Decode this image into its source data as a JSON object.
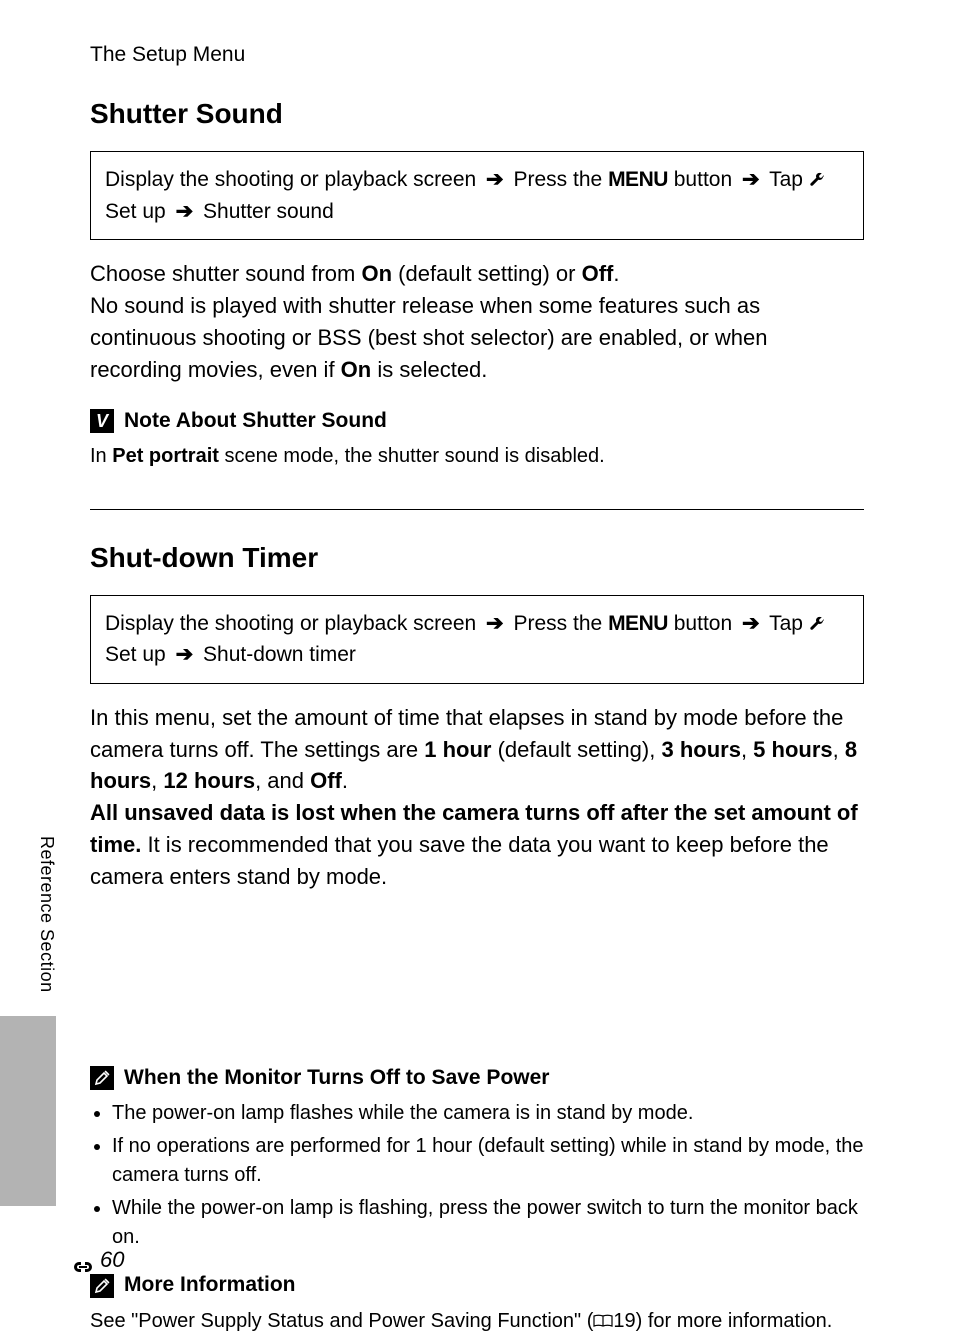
{
  "header": "The Setup Menu",
  "section1": {
    "title": "Shutter Sound",
    "nav": {
      "p1": "Display the shooting or playback screen",
      "p2": "Press the",
      "menu": "MENU",
      "p3": "button",
      "p4": "Tap",
      "p5": "Set up",
      "p6": "Shutter sound"
    },
    "para1_a": "Choose shutter sound from ",
    "para1_on": "On",
    "para1_b": " (default setting) or ",
    "para1_off": "Off",
    "para1_c": ".",
    "para2_a": "No sound is played with shutter release when some features such as continuous shooting or BSS (best shot selector) are enabled, or when recording movies, even if ",
    "para2_on": "On",
    "para2_b": " is selected.",
    "note": {
      "title": "Note About Shutter Sound",
      "body_a": "In ",
      "body_b": "Pet portrait",
      "body_c": " scene mode, the shutter sound is disabled."
    }
  },
  "section2": {
    "title": "Shut-down Timer",
    "nav": {
      "p1": "Display the shooting or playback screen",
      "p2": "Press the",
      "menu": "MENU",
      "p3": "button",
      "p4": "Tap",
      "p5": "Set up",
      "p6": "Shut-down timer"
    },
    "para1_a": "In this menu, set the amount of time that elapses in stand by mode before the camera turns off. The settings are ",
    "s_1h": "1 hour",
    "para1_b": " (default setting), ",
    "s_3h": "3 hours",
    "comma": ", ",
    "s_5h": "5 hours",
    "s_8h": "8 hours",
    "s_12h": "12 hours",
    "and": ", and ",
    "s_off": "Off",
    "period": ".",
    "para2_a": "All unsaved data is lost when the camera turns off after the set amount of time.",
    "para2_b": " It is recommended that you save the data you want to keep before the camera enters stand by mode.",
    "noteA": {
      "title": "When the Monitor Turns Off to Save Power",
      "bullets": [
        "The power-on lamp flashes while the camera is in stand by mode.",
        "If no operations are performed for 1 hour (default setting) while in stand by mode, the camera turns off.",
        "While the power-on lamp is flashing, press the power switch to turn the monitor back on."
      ]
    },
    "noteB": {
      "title": "More Information",
      "body_a": "See \"Power Supply Status and Power Saving Function\" (",
      "body_ref": "19",
      "body_b": ") for more information."
    }
  },
  "side_label": "Reference Section",
  "page_number": "60"
}
